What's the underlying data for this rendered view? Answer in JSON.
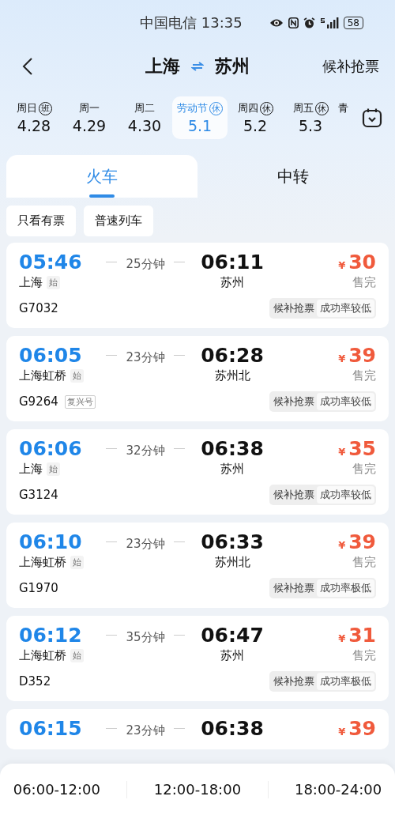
{
  "status_bar": {
    "carrier": "中国电信",
    "time": "13:35",
    "battery": "58"
  },
  "header": {
    "from": "上海",
    "to": "苏州",
    "action": "候补抢票"
  },
  "dates": [
    {
      "day": "周日",
      "date": "4.28",
      "badge": "班",
      "selected": false
    },
    {
      "day": "周一",
      "date": "4.29",
      "selected": false
    },
    {
      "day": "周二",
      "date": "4.30",
      "selected": false
    },
    {
      "day": "劳动节",
      "date": "5.1",
      "badge": "休",
      "selected": true
    },
    {
      "day": "周四",
      "date": "5.2",
      "badge": "休",
      "selected": false
    },
    {
      "day": "周五",
      "date": "5.3",
      "badge": "休",
      "selected": false
    },
    {
      "day": "青",
      "selected": false
    }
  ],
  "tabs": [
    {
      "label": "火车",
      "selected": true
    },
    {
      "label": "中转",
      "selected": false
    }
  ],
  "filters": [
    {
      "label": "只看有票",
      "selected": false
    },
    {
      "label": "普速列车",
      "selected": false
    }
  ],
  "trains": [
    {
      "depart": "05:46",
      "duration": "25分钟",
      "arrive": "06:11",
      "price": "30",
      "from": "上海",
      "origin_badge": "始",
      "to": "苏州",
      "status": "售完",
      "number": "G7032",
      "waitlist": "候补抢票",
      "rate": "成功率较低"
    },
    {
      "depart": "06:05",
      "duration": "23分钟",
      "arrive": "06:28",
      "price": "39",
      "from": "上海虹桥",
      "origin_badge": "始",
      "to": "苏州北",
      "status": "售完",
      "number": "G9264",
      "train_tag": "复兴号",
      "waitlist": "候补抢票",
      "rate": "成功率较低"
    },
    {
      "depart": "06:06",
      "duration": "32分钟",
      "arrive": "06:38",
      "price": "35",
      "from": "上海",
      "origin_badge": "始",
      "to": "苏州",
      "status": "售完",
      "number": "G3124",
      "waitlist": "候补抢票",
      "rate": "成功率较低"
    },
    {
      "depart": "06:10",
      "duration": "23分钟",
      "arrive": "06:33",
      "price": "39",
      "from": "上海虹桥",
      "origin_badge": "始",
      "to": "苏州北",
      "status": "售完",
      "number": "G1970",
      "waitlist": "候补抢票",
      "rate": "成功率极低"
    },
    {
      "depart": "06:12",
      "duration": "35分钟",
      "arrive": "06:47",
      "price": "31",
      "from": "上海虹桥",
      "origin_badge": "始",
      "to": "苏州",
      "status": "售完",
      "number": "D352",
      "waitlist": "候补抢票",
      "rate": "成功率极低"
    },
    {
      "depart": "06:15",
      "duration": "23分钟",
      "arrive": "06:38",
      "price": "39"
    }
  ],
  "currency": "¥",
  "time_ranges": [
    "06:00-12:00",
    "12:00-18:00",
    "18:00-24:00"
  ]
}
